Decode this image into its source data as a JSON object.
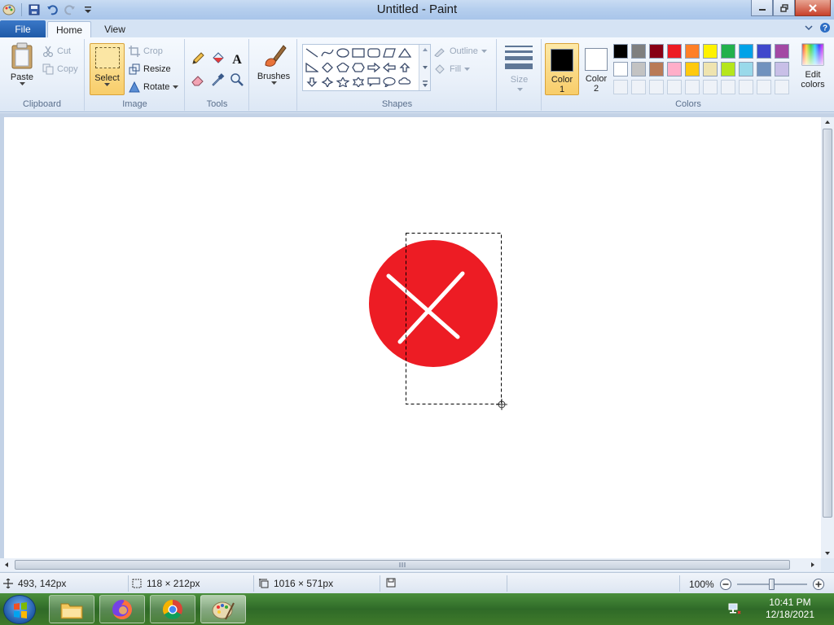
{
  "window": {
    "title": "Untitled - Paint"
  },
  "menu": {
    "file": "File",
    "tabs": [
      "Home",
      "View"
    ]
  },
  "clipboard": {
    "paste": "Paste",
    "cut": "Cut",
    "copy": "Copy",
    "group": "Clipboard"
  },
  "image": {
    "select": "Select",
    "crop": "Crop",
    "resize": "Resize",
    "rotate": "Rotate",
    "group": "Image"
  },
  "tools": {
    "group": "Tools"
  },
  "brushes": {
    "label": "Brushes"
  },
  "shapes": {
    "outline": "Outline",
    "fill": "Fill",
    "group": "Shapes"
  },
  "size": {
    "label": "Size"
  },
  "colors": {
    "color1_label": "Color",
    "color1_num": "1",
    "color2_label": "Color",
    "color2_num": "2",
    "edit_label": "Edit",
    "edit_label2": "colors",
    "group": "Colors",
    "color1": "#000000",
    "color2": "#ffffff",
    "palette_row1": [
      "#000000",
      "#7f7f7f",
      "#880015",
      "#ed1c24",
      "#ff7f27",
      "#fff200",
      "#22b14c",
      "#00a2e8",
      "#3f48cc",
      "#a349a4"
    ],
    "palette_row2": [
      "#ffffff",
      "#c3c3c3",
      "#b97a57",
      "#ffaec9",
      "#ffc90e",
      "#efe4b0",
      "#b5e61d",
      "#99d9ea",
      "#7092be",
      "#c8bfe7"
    ]
  },
  "canvas": {
    "shape_color": "#ed1c24",
    "mark_color": "#ffffff"
  },
  "status": {
    "cursor_pos": "493, 142px",
    "selection_size": "118 × 212px",
    "image_size": "1016 × 571px",
    "zoom": "100%"
  },
  "taskbar": {
    "time": "10:41 PM",
    "date": "12/18/2021"
  }
}
